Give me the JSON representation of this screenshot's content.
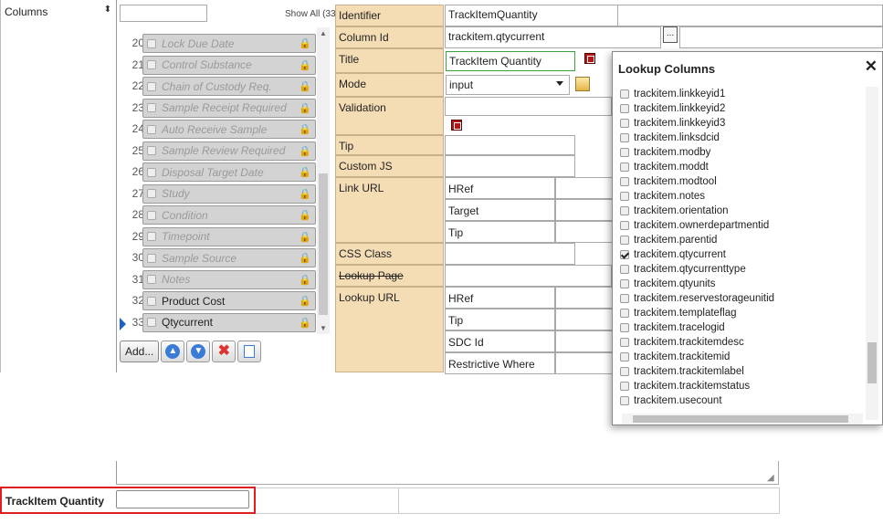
{
  "sidebar": {
    "label": "Columns"
  },
  "column_list": {
    "show_all": "Show All (33)",
    "rows": [
      {
        "num": "20",
        "label": "Lock Due Date",
        "active": false
      },
      {
        "num": "21",
        "label": "Control Substance",
        "active": false
      },
      {
        "num": "22",
        "label": "Chain of Custody Req.",
        "active": false
      },
      {
        "num": "23",
        "label": "Sample Receipt Required",
        "active": false
      },
      {
        "num": "24",
        "label": "Auto Receive Sample",
        "active": false
      },
      {
        "num": "25",
        "label": "Sample Review Required",
        "active": false
      },
      {
        "num": "26",
        "label": "Disposal Target Date",
        "active": false
      },
      {
        "num": "27",
        "label": "Study",
        "active": false
      },
      {
        "num": "28",
        "label": "Condition",
        "active": false
      },
      {
        "num": "29",
        "label": "Timepoint",
        "active": false
      },
      {
        "num": "30",
        "label": "Sample Source",
        "active": false
      },
      {
        "num": "31",
        "label": "Notes",
        "active": false
      },
      {
        "num": "32",
        "label": "Product Cost",
        "active": true
      },
      {
        "num": "33",
        "label": "Qtycurrent",
        "active": true
      }
    ],
    "add_label": "Add..."
  },
  "properties": {
    "identifier_label": "Identifier",
    "identifier_value": "TrackItemQuantity",
    "column_id_label": "Column Id",
    "column_id_value": "trackitem.qtycurrent",
    "ellipsis": "...",
    "title_label": "Title",
    "title_value": "TrackItem Quantity",
    "mode_label": "Mode",
    "mode_value": "input",
    "validation_label": "Validation",
    "tip_label": "Tip",
    "custom_js_label": "Custom JS",
    "link_url_label": "Link URL",
    "link_href": "HRef",
    "link_target": "Target",
    "link_tip": "Tip",
    "css_class_label": "CSS Class",
    "lookup_page_label": "Lookup Page",
    "lookup_url_label": "Lookup URL",
    "lookup_href": "HRef",
    "lookup_tip": "Tip",
    "lookup_sdc": "SDC Id",
    "lookup_where": "Restrictive Where"
  },
  "lookup_popup": {
    "title": "Lookup Columns",
    "close": "✕",
    "items": [
      {
        "label": "trackitem.linkkeyid1",
        "checked": false
      },
      {
        "label": "trackitem.linkkeyid2",
        "checked": false
      },
      {
        "label": "trackitem.linkkeyid3",
        "checked": false
      },
      {
        "label": "trackitem.linksdcid",
        "checked": false
      },
      {
        "label": "trackitem.modby",
        "checked": false
      },
      {
        "label": "trackitem.moddt",
        "checked": false
      },
      {
        "label": "trackitem.modtool",
        "checked": false
      },
      {
        "label": "trackitem.notes",
        "checked": false
      },
      {
        "label": "trackitem.orientation",
        "checked": false
      },
      {
        "label": "trackitem.ownerdepartmentid",
        "checked": false
      },
      {
        "label": "trackitem.parentid",
        "checked": false
      },
      {
        "label": "trackitem.qtycurrent",
        "checked": true
      },
      {
        "label": "trackitem.qtycurrenttype",
        "checked": false
      },
      {
        "label": "trackitem.qtyunits",
        "checked": false
      },
      {
        "label": "trackitem.reservestorageunitid",
        "checked": false
      },
      {
        "label": "trackitem.templateflag",
        "checked": false
      },
      {
        "label": "trackitem.tracelogid",
        "checked": false
      },
      {
        "label": "trackitem.trackitemdesc",
        "checked": false
      },
      {
        "label": "trackitem.trackitemid",
        "checked": false
      },
      {
        "label": "trackitem.trackitemlabel",
        "checked": false
      },
      {
        "label": "trackitem.trackitemstatus",
        "checked": false
      },
      {
        "label": "trackitem.usecount",
        "checked": false
      }
    ]
  },
  "preview": {
    "label": "TrackItem Quantity"
  },
  "colors": {
    "label_bg": "#f4dcb4",
    "highlight": "#e02020",
    "selection_arrow": "#1f5fcf"
  }
}
